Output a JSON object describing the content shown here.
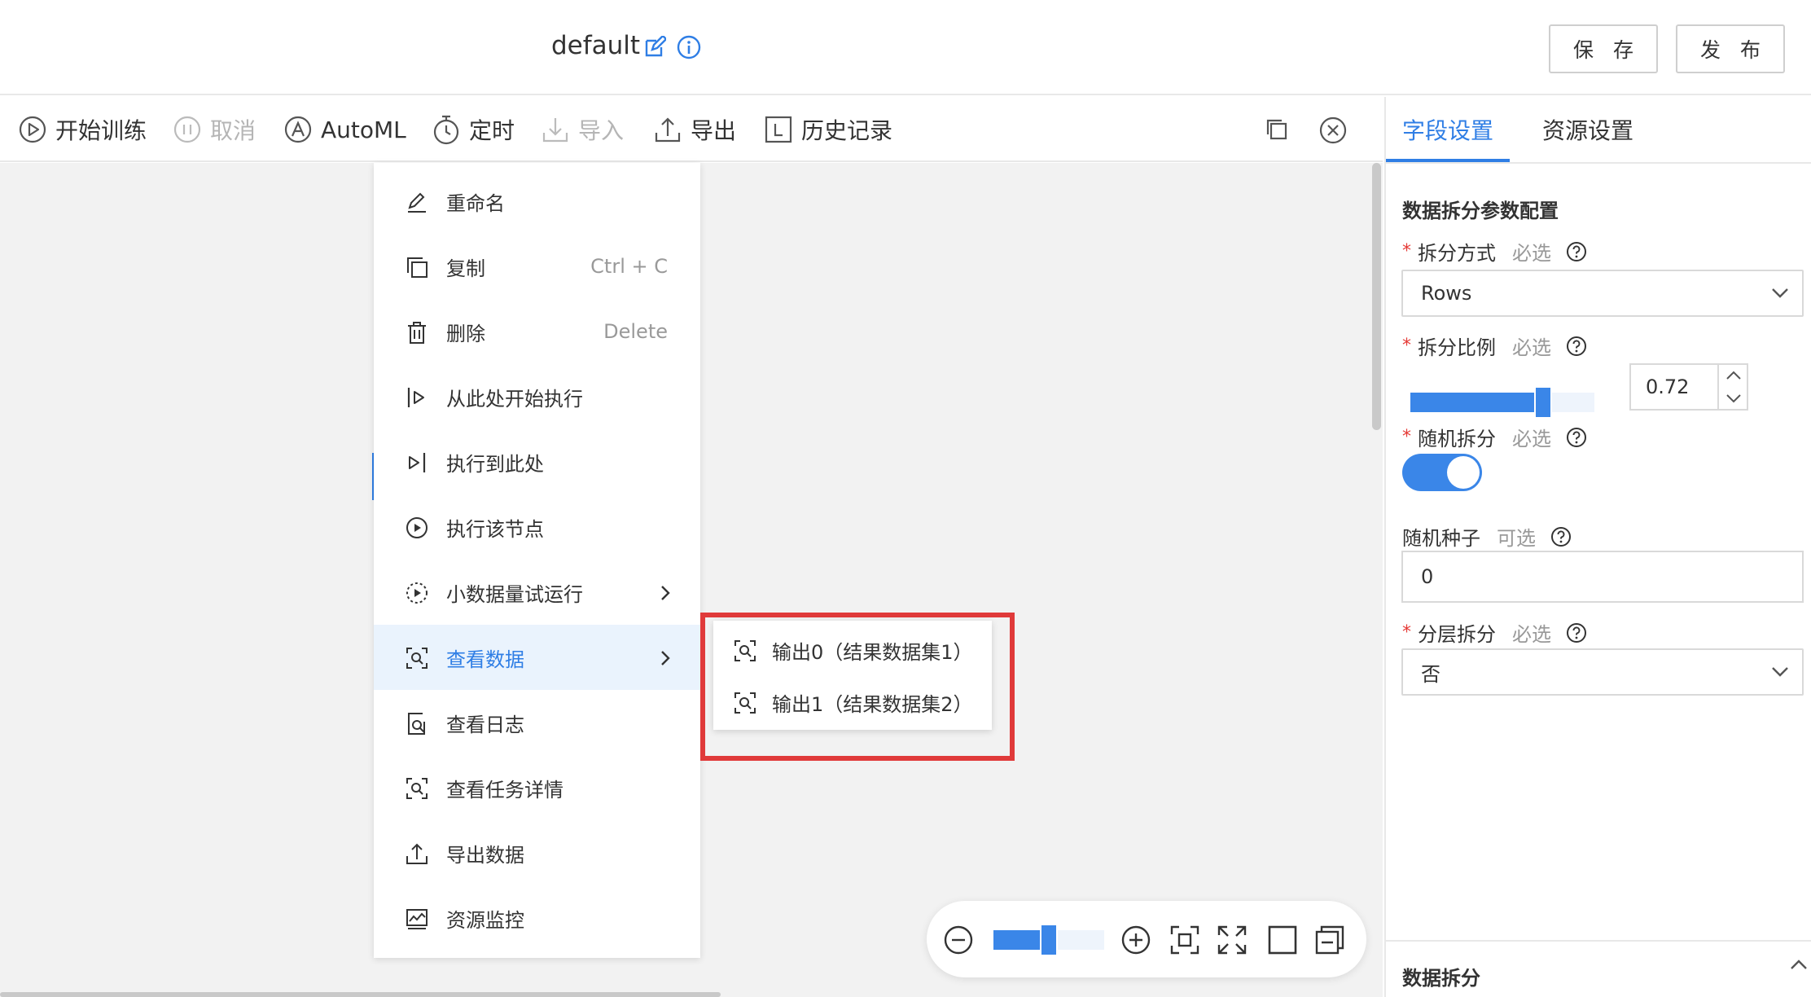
{
  "header": {
    "title": "default",
    "save_label": "保 存",
    "publish_label": "发 布"
  },
  "toolbar": {
    "items": [
      {
        "label": "开始训练",
        "icon": "play-circle-icon",
        "disabled": false
      },
      {
        "label": "取消",
        "icon": "pause-circle-icon",
        "disabled": true
      },
      {
        "label": "AutoML",
        "icon": "automl-icon",
        "disabled": false
      },
      {
        "label": "定时",
        "icon": "timer-icon",
        "disabled": false
      },
      {
        "label": "导入",
        "icon": "import-icon",
        "disabled": true
      },
      {
        "label": "导出",
        "icon": "export-icon",
        "disabled": false
      },
      {
        "label": "历史记录",
        "icon": "history-icon",
        "disabled": false
      }
    ]
  },
  "context_menu": {
    "items": [
      {
        "label": "重命名",
        "shortcut": "",
        "icon": "pencil-icon"
      },
      {
        "label": "复制",
        "shortcut": "Ctrl + C",
        "icon": "copy-icon"
      },
      {
        "label": "删除",
        "shortcut": "Delete",
        "icon": "trash-icon"
      },
      {
        "label": "从此处开始执行",
        "shortcut": "",
        "icon": "run-from-here-icon"
      },
      {
        "label": "执行到此处",
        "shortcut": "",
        "icon": "run-to-here-icon"
      },
      {
        "label": "执行该节点",
        "shortcut": "",
        "icon": "run-node-icon"
      },
      {
        "label": "小数据量试运行",
        "shortcut": "",
        "icon": "trial-run-icon",
        "submenu": true
      },
      {
        "label": "查看数据",
        "shortcut": "",
        "icon": "view-data-icon",
        "submenu": true,
        "active": true
      },
      {
        "label": "查看日志",
        "shortcut": "",
        "icon": "view-log-icon"
      },
      {
        "label": "查看任务详情",
        "shortcut": "",
        "icon": "task-detail-icon"
      },
      {
        "label": "导出数据",
        "shortcut": "",
        "icon": "export-data-icon"
      },
      {
        "label": "资源监控",
        "shortcut": "",
        "icon": "resource-monitor-icon"
      }
    ]
  },
  "submenu": {
    "items": [
      {
        "label": "输出0（结果数据集1）",
        "icon": "view-data-icon"
      },
      {
        "label": "输出1（结果数据集2）",
        "icon": "view-data-icon"
      }
    ]
  },
  "zoom": {
    "level": 0.5
  },
  "right_panel": {
    "tabs": [
      {
        "label": "字段设置",
        "active": true
      },
      {
        "label": "资源设置",
        "active": false
      }
    ],
    "section_title": "数据拆分参数配置",
    "split_method": {
      "label": "拆分方式",
      "hint": "必选",
      "value": "Rows"
    },
    "split_ratio": {
      "label": "拆分比例",
      "hint": "必选",
      "value": "0.72",
      "fraction": 0.72
    },
    "random_split": {
      "label": "随机拆分",
      "hint": "必选",
      "on": true
    },
    "random_seed": {
      "label": "随机种子",
      "hint": "可选",
      "value": "0"
    },
    "stratified_split": {
      "label": "分层拆分",
      "hint": "必选",
      "value": "否"
    },
    "footer_title": "数据拆分"
  },
  "colors": {
    "accent": "#2f7ee5",
    "highlight_border": "#e03a3a",
    "required": "#e53935"
  }
}
